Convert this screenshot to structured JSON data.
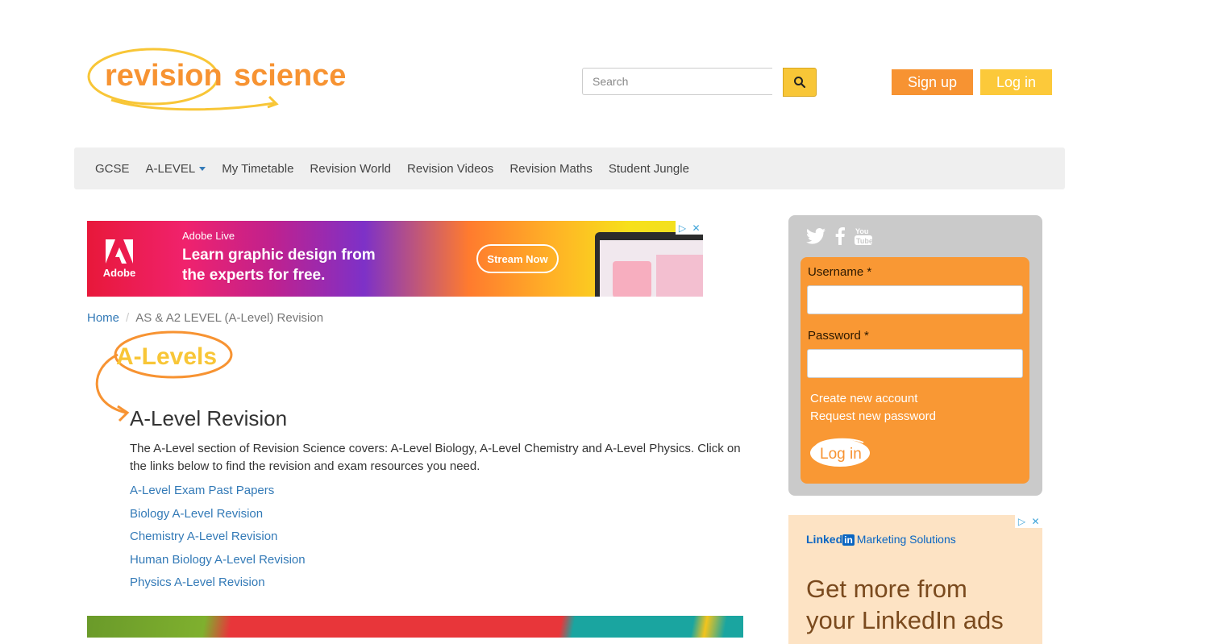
{
  "brand": {
    "name_part1": "revision",
    "name_part2": "science"
  },
  "search": {
    "placeholder": "Search"
  },
  "header": {
    "signup_label": "Sign up",
    "login_label": "Log in"
  },
  "nav": {
    "items": [
      {
        "label": "GCSE"
      },
      {
        "label": "A-LEVEL",
        "has_dropdown": true
      },
      {
        "label": "My Timetable"
      },
      {
        "label": "Revision World"
      },
      {
        "label": "Revision Videos"
      },
      {
        "label": "Revision Maths"
      },
      {
        "label": "Student Jungle"
      }
    ]
  },
  "ad_banner": {
    "brand": "Adobe",
    "subtitle": "Adobe Live",
    "headline": "Learn graphic design from the experts for free.",
    "cta": "Stream Now"
  },
  "breadcrumb": {
    "home": "Home",
    "current": "AS & A2 LEVEL (A-Level) Revision"
  },
  "badge_text": "A-Levels",
  "main": {
    "title": "A-Level Revision",
    "intro": "The A-Level section of Revision Science covers: A-Level Biology, A-Level Chemistry and A-Level Physics. Click on the links below to find the revision and exam resources you need.",
    "links": [
      "A-Level Exam Past Papers",
      "Biology A-Level Revision",
      "Chemistry A-Level Revision",
      "Human Biology A-Level Revision",
      "Physics A-Level Revision"
    ]
  },
  "login_panel": {
    "username_label": "Username *",
    "password_label": "Password *",
    "create_account": "Create new account",
    "request_password": "Request new password",
    "submit_label": "Log in",
    "social_icons": [
      "twitter-icon",
      "facebook-icon",
      "youtube-icon"
    ]
  },
  "ad_side": {
    "brand_part1": "Linked",
    "brand_part2": "in",
    "brand_part3": "Marketing Solutions",
    "headline_line1": "Get more from",
    "headline_line2": "your LinkedIn ads"
  },
  "colors": {
    "brand_orange": "#f79332",
    "brand_yellow": "#fcc93a",
    "link_blue": "#337ab7",
    "login_box": "#f99834",
    "panel_grey": "#cacaca"
  }
}
